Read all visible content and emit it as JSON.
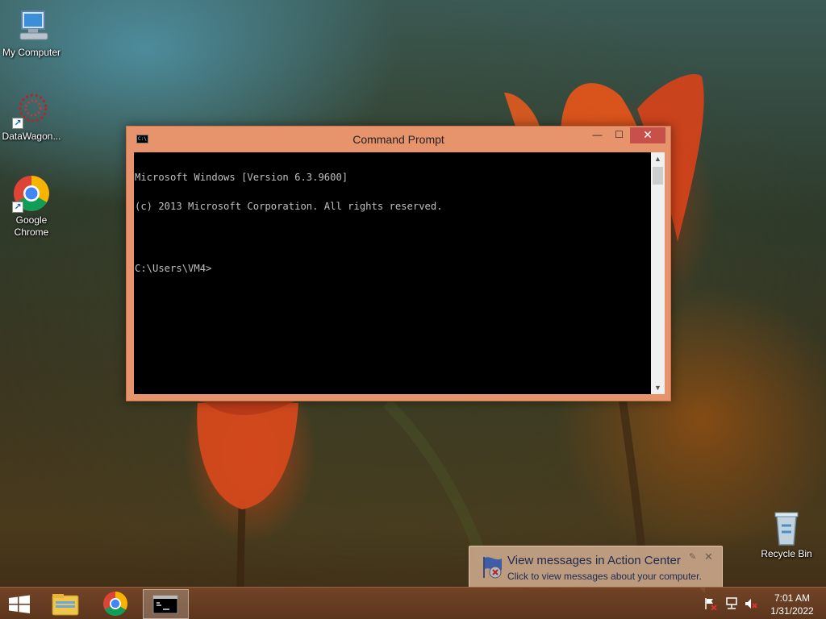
{
  "desktop": {
    "icons": [
      {
        "label": "My Computer",
        "icon": "my-computer-icon"
      },
      {
        "label": "DataWagon...",
        "icon": "datawagon-icon"
      },
      {
        "label": "Google\nChrome",
        "icon": "chrome-icon"
      },
      {
        "label": "Recycle Bin",
        "icon": "recycle-bin-icon"
      }
    ]
  },
  "window": {
    "title": "Command Prompt",
    "icon_text": "C:\\",
    "controls": {
      "minimize": "—",
      "maximize": "☐",
      "close": "✕"
    },
    "console_lines": [
      "Microsoft Windows [Version 6.3.9600]",
      "(c) 2013 Microsoft Corporation. All rights reserved.",
      "",
      "C:\\Users\\VM4>"
    ]
  },
  "notification": {
    "title": "View messages in Action Center",
    "body": "Click to view messages about your computer."
  },
  "taskbar": {
    "apps": [
      "start-icon",
      "file-explorer-icon",
      "chrome-icon",
      "command-prompt-icon"
    ],
    "clock": {
      "time": "7:01 AM",
      "date": "1/31/2022"
    }
  },
  "colors": {
    "window_frame": "#e7946c",
    "close_button": "#c7504a",
    "console_bg": "#000000",
    "console_fg": "#c0c0c0"
  }
}
